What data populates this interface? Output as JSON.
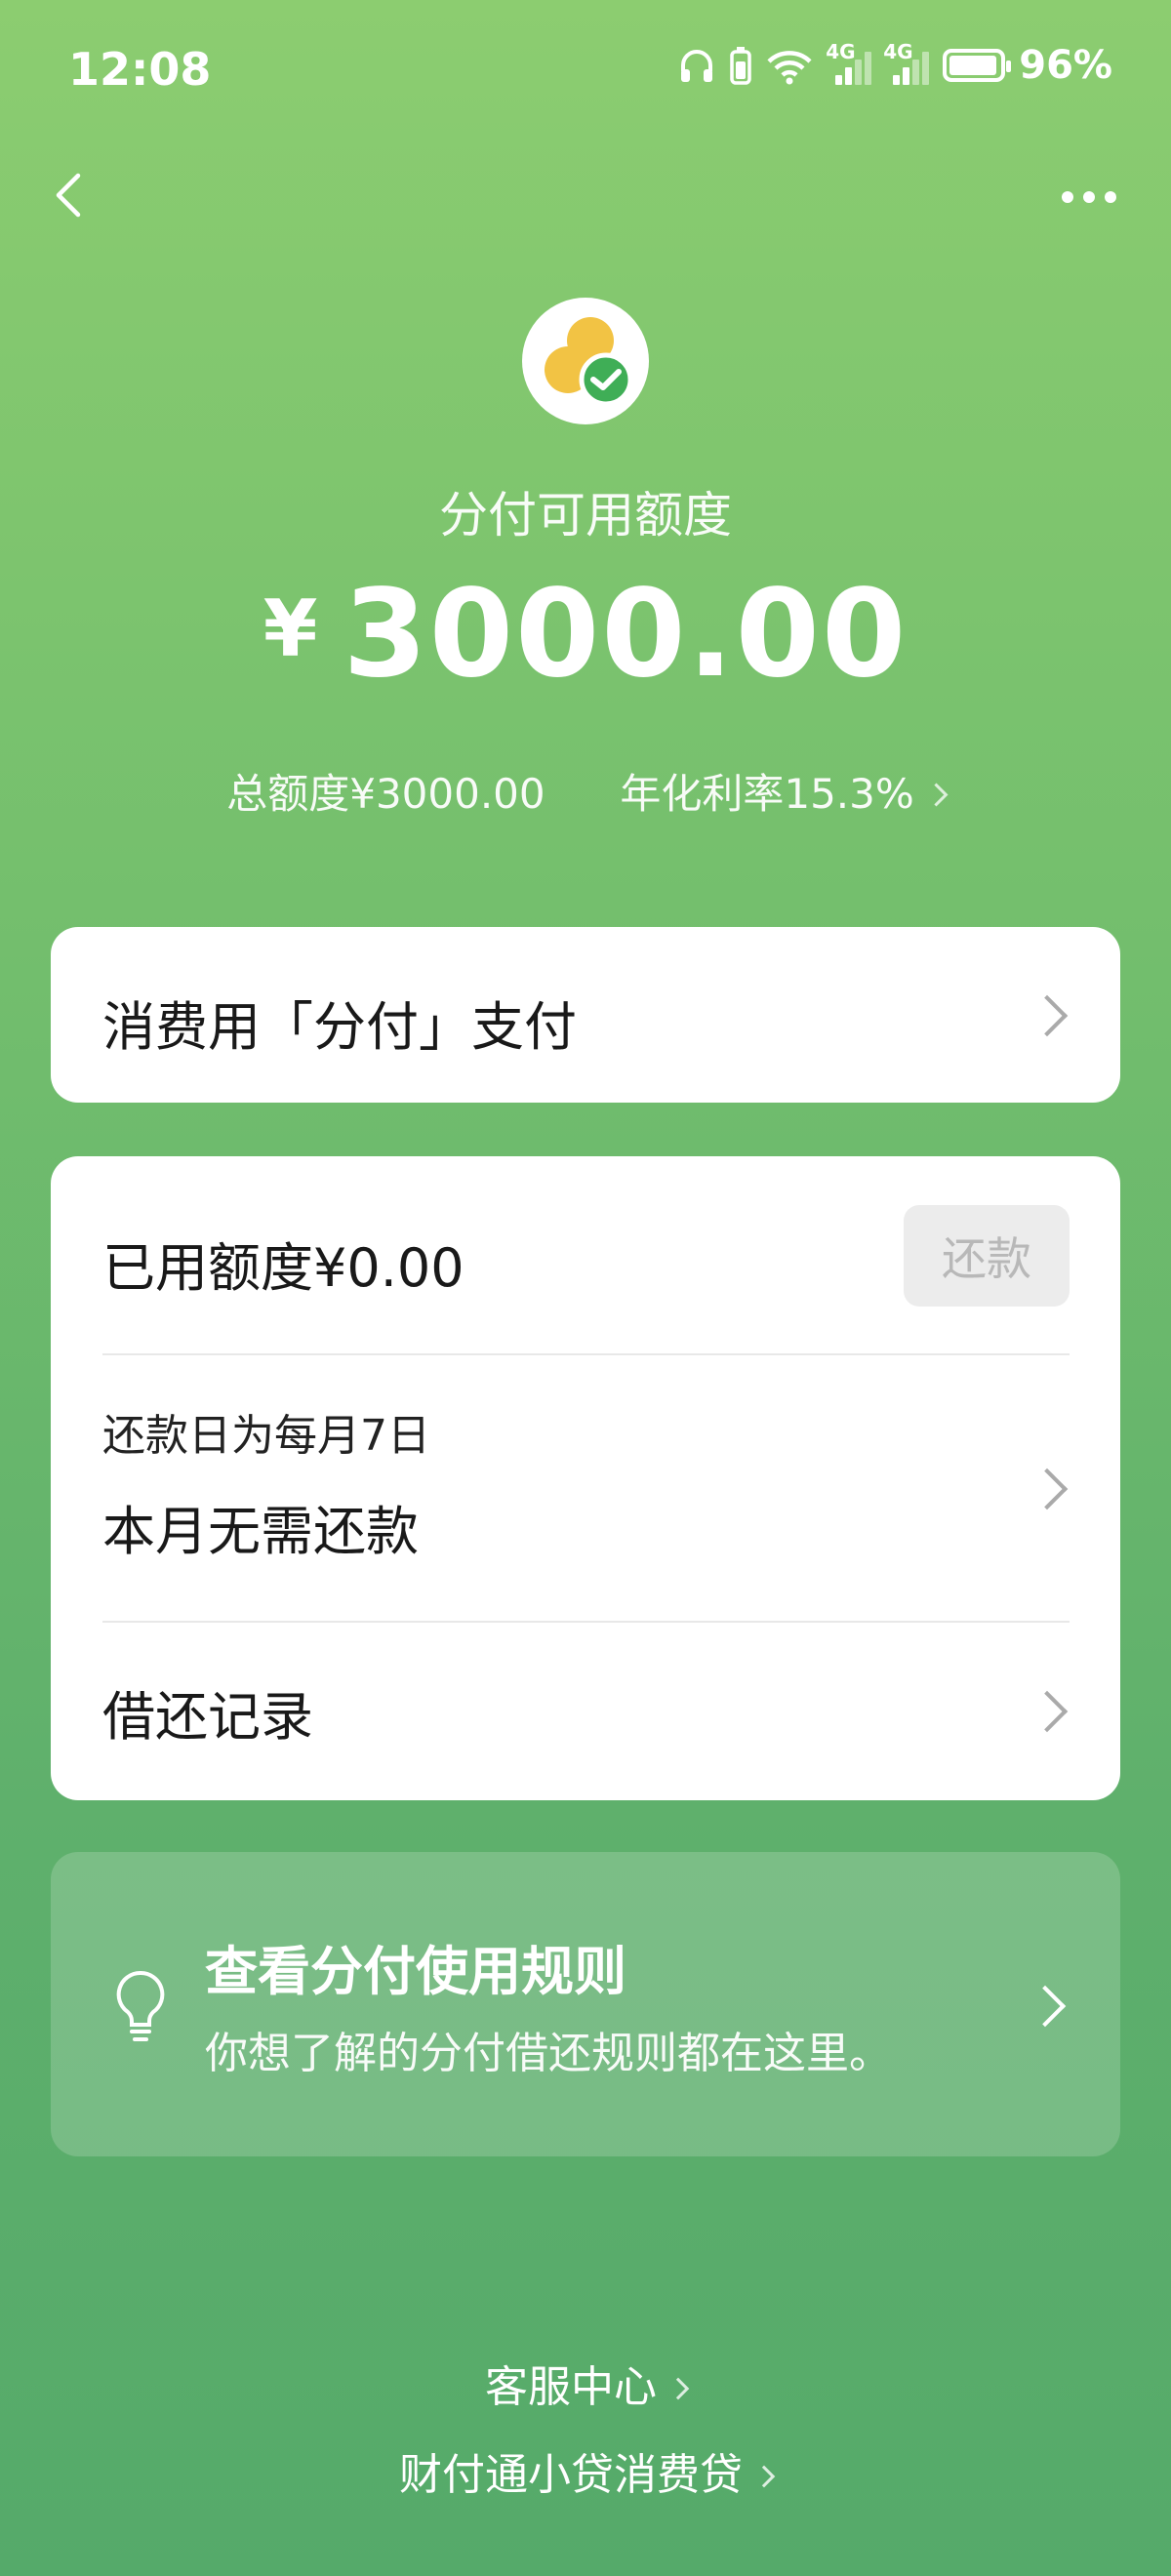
{
  "status_bar": {
    "time": "12:08",
    "network_1": "4G",
    "network_2": "4G",
    "battery": "96%",
    "battery_level": 0.96,
    "wifi_badge": "6"
  },
  "header": {
    "back_icon": "chevron-left-icon",
    "more_icon": "more-dots-icon"
  },
  "logo": {
    "icon": "fenfu-logo-icon"
  },
  "credit": {
    "title": "分付可用额度",
    "currency": "¥",
    "amount": "3000.00",
    "total_limit": "总额度¥3000.00",
    "annual_rate": "年化利率15.3%"
  },
  "pay_card": {
    "label": "消费用「分付」支付"
  },
  "usage_card": {
    "used_label": "已用额度¥0.00",
    "repay_button": "还款",
    "due_day": "还款日为每月7日",
    "due_status": "本月无需还款",
    "records": "借还记录"
  },
  "rules_card": {
    "title": "查看分付使用规则",
    "subtitle": "你想了解的分付借还规则都在这里。",
    "icon": "lightbulb-icon"
  },
  "footer": {
    "service_center": "客服中心",
    "lender": "财付通小贷消费贷"
  },
  "colors": {
    "bg_top": "#8ccd70",
    "bg_bottom": "#55aa6a",
    "logo_yellow": "#f2c344",
    "logo_green": "#3fae56"
  }
}
